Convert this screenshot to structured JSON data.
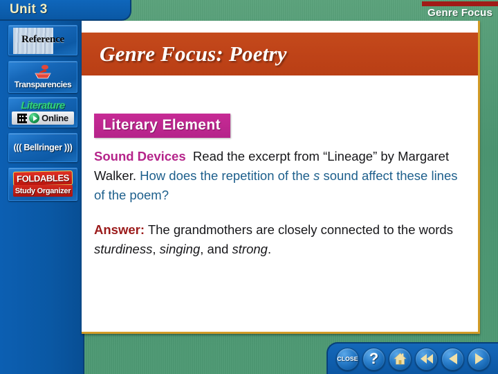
{
  "window": {
    "unit_tab_label": "Unit 3",
    "top_right_title": "Genre Focus"
  },
  "sidebar": {
    "items": [
      {
        "name": "reference",
        "label": "Reference"
      },
      {
        "name": "transparencies",
        "label": "Transparencies"
      },
      {
        "name": "literature-online",
        "label_primary": "Literature",
        "label_secondary": "Online"
      },
      {
        "name": "bellringer",
        "label": "((( Bellringer )))"
      },
      {
        "name": "foldables",
        "label_primary": "FOLDABLES",
        "label_secondary": "Study Organizer"
      }
    ]
  },
  "main": {
    "banner_title": "Genre Focus: Poetry",
    "badge_label": "Literary Element",
    "question": {
      "term": "Sound Devices",
      "prompt_black": "Read the excerpt from “Lineage” by Margaret Walker.",
      "prompt_blue_1": "How does the repetition of the",
      "prompt_italic": "s",
      "prompt_blue_2": "sound affect these lines of the poem?"
    },
    "answer": {
      "label": "Answer:",
      "text_1": "The grandmothers are closely connected to the words",
      "italic_1": "sturdiness",
      "sep_1": ",",
      "italic_2": "singing",
      "sep_2": ", and",
      "italic_3": "strong",
      "sep_3": "."
    }
  },
  "nav": {
    "buttons": [
      {
        "name": "close-button",
        "label": "CLOSE"
      },
      {
        "name": "help-button",
        "label": "?"
      },
      {
        "name": "home-button",
        "label": "home"
      },
      {
        "name": "rewind-button",
        "label": "rewind"
      },
      {
        "name": "previous-button",
        "label": "previous"
      },
      {
        "name": "next-button",
        "label": "next"
      }
    ]
  },
  "colors": {
    "blue_panel": "#0a58a4",
    "green_bg": "#4a9470",
    "banner_orange": "#bf4318",
    "badge_magenta": "#b5248a",
    "accent_blue_text": "#1d5f8c",
    "answer_red": "#9b1b1b",
    "gold_border": "#d39c27",
    "top_bar_red": "#a01b17",
    "unit_tab_text": "#f2edc0"
  }
}
